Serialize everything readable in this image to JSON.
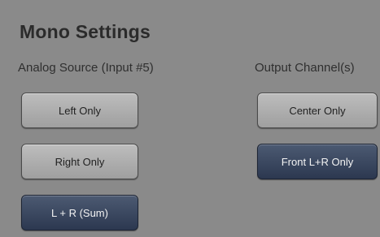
{
  "title": "Mono Settings",
  "analog": {
    "label": "Analog Source (Input #5)",
    "buttons": [
      {
        "label": "Left Only",
        "selected": false
      },
      {
        "label": "Right Only",
        "selected": false
      },
      {
        "label": "L + R (Sum)",
        "selected": true
      }
    ]
  },
  "output": {
    "label": "Output Channel(s)",
    "buttons": [
      {
        "label": "Center Only",
        "selected": false
      },
      {
        "label": "Front L+R Only",
        "selected": true
      }
    ]
  },
  "colors": {
    "background": "#8a8a8a",
    "button_light": "#b0b0b0",
    "button_selected": "#3a4862"
  }
}
